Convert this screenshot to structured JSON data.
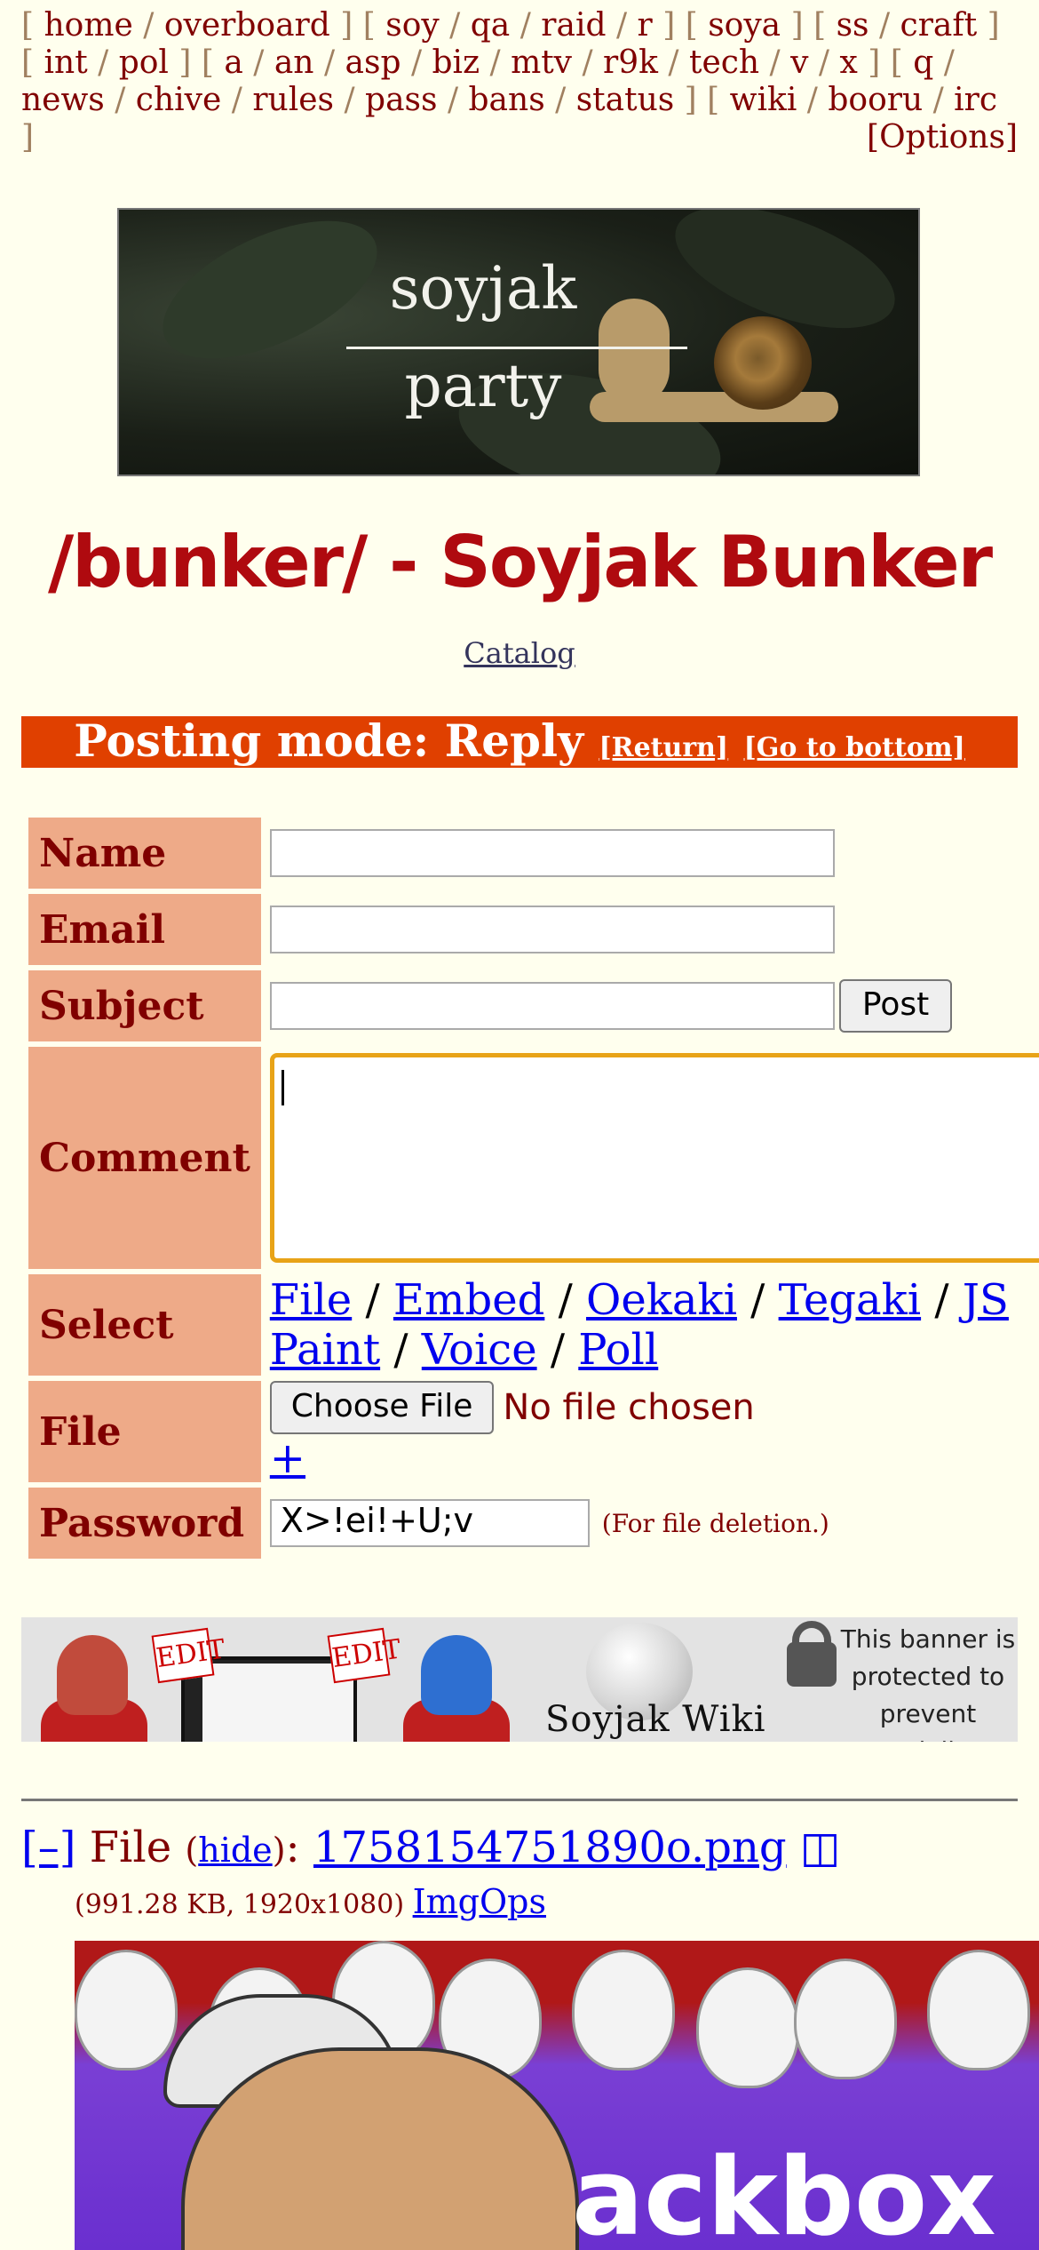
{
  "boardlist": {
    "groups": [
      [
        "home",
        "overboard"
      ],
      [
        "soy",
        "qa",
        "raid",
        "r"
      ],
      [
        "soya"
      ],
      [
        "ss",
        "craft"
      ],
      [
        "int",
        "pol"
      ],
      [
        "a",
        "an",
        "asp",
        "biz",
        "mtv",
        "r9k",
        "tech",
        "v",
        "x"
      ],
      [
        "q",
        "news",
        "chive",
        "rules",
        "pass",
        "bans",
        "status"
      ],
      [
        "wiki",
        "booru",
        "irc"
      ]
    ],
    "options_label": "[Options]"
  },
  "banner": {
    "line1": "soyjak",
    "line2": "party"
  },
  "board_title": "/bunker/ - Soyjak Bunker",
  "catalog_label": "Catalog",
  "posting_mode": {
    "label": "Posting mode: Reply",
    "return_label": "[Return]",
    "bottom_label": "[Go to bottom]"
  },
  "form": {
    "name_label": "Name",
    "email_label": "Email",
    "subject_label": "Subject",
    "post_button": "Post",
    "comment_label": "Comment",
    "select_label": "Select",
    "select_links": [
      "File",
      "Embed",
      "Oekaki",
      "Tegaki",
      "JS Paint",
      "Voice",
      "Poll"
    ],
    "file_label": "File",
    "choose_file": "Choose File",
    "no_file": "No file chosen",
    "plus": "+",
    "password_label": "Password",
    "password_value": "X>!ei!+U;v",
    "password_hint": "(For file deletion.)"
  },
  "ad_banner": {
    "edit_text": "EDIT",
    "wiki_text": "Soyjak Wiki",
    "protected_text": "This banner is protected to prevent vandalism"
  },
  "post": {
    "collapse": "[–]",
    "file_word": "File",
    "hide_label": "hide",
    "filename": "1758154751890o.png",
    "meta": "(991.28 KB, 1920x1080)",
    "imgops": "ImgOps",
    "thumb_text": "ackbox"
  },
  "colors": {
    "background": "#ffffee",
    "board_title": "#af0a0f",
    "mode_bar": "#e04000",
    "label_cell": "#eeaa88",
    "link": "#0000ee"
  }
}
